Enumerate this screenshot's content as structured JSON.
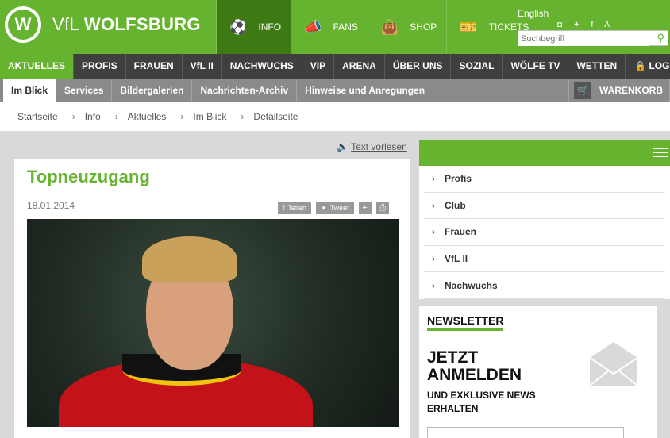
{
  "header": {
    "logo_letter": "W",
    "brand_prefix": "VfL",
    "brand_name": "WOLFSBURG",
    "topnav": [
      {
        "icon": "soccer-ball-icon",
        "glyph": "⚽",
        "label": "INFO"
      },
      {
        "icon": "megaphone-icon",
        "glyph": "📣",
        "label": "FANS"
      },
      {
        "icon": "shopping-bag-icon",
        "glyph": "👜",
        "label": "SHOP"
      },
      {
        "icon": "ticket-icon",
        "glyph": "🎫",
        "label": "TICKETS"
      }
    ],
    "language": "English",
    "search_placeholder": "Suchbegriff"
  },
  "mainnav": {
    "items": [
      "AKTUELLES",
      "PROFIS",
      "FRAUEN",
      "VfL II",
      "NACHWUCHS",
      "VIP",
      "ARENA",
      "ÜBER UNS",
      "SOZIAL",
      "WÖLFE TV",
      "WETTEN"
    ],
    "login": "LOGIN"
  },
  "subnav": {
    "items": [
      "Im Blick",
      "Services",
      "Bildergalerien",
      "Nachrichten-Archiv",
      "Hinweise und Anregungen"
    ],
    "cart": "WARENKORB"
  },
  "breadcrumb": [
    "Startseite",
    "Info",
    "Aktuelles",
    "Im Blick",
    "Detailseite"
  ],
  "article": {
    "read_aloud": "Text vorlesen",
    "title": "Topneuzugang",
    "date": "18.01.2014",
    "share_facebook": "Teilen",
    "share_twitter": "Tweet"
  },
  "sidebar": {
    "items": [
      "Profis",
      "Club",
      "Frauen",
      "VfL II",
      "Nachwuchs"
    ]
  },
  "newsletter": {
    "label": "NEWSLETTER",
    "headline": "JETZT ANMELDEN",
    "sub": "UND EXKLUSIVE NEWS ERHALTEN"
  },
  "colors": {
    "brand_green": "#65b32e",
    "nav_dark": "#3f3f3f",
    "subnav_gray": "#8a8a8a"
  }
}
